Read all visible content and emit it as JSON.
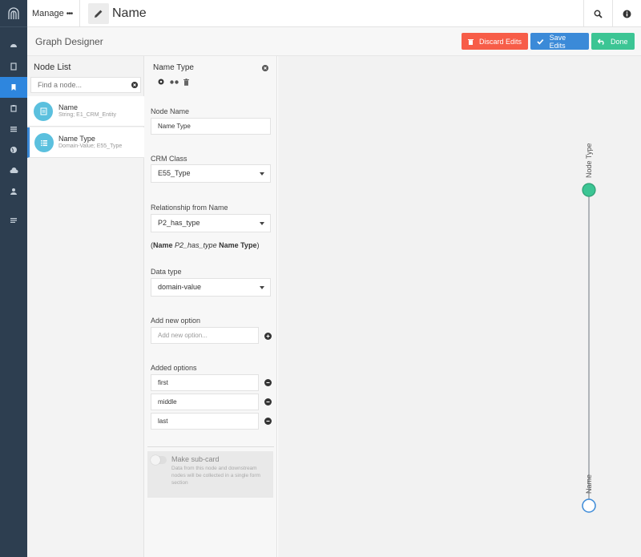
{
  "topbar": {
    "manage_label": "Manage",
    "manage_dots": "•••",
    "page_title": "Name"
  },
  "toolbar": {
    "section_title": "Graph Designer",
    "discard_label": "Discard Edits",
    "save_label": "Save Edits",
    "done_label": "Done"
  },
  "node_list": {
    "title": "Node List",
    "search_placeholder": "Find a node...",
    "items": [
      {
        "name": "Name",
        "sub": "String; E1_CRM_Entity"
      },
      {
        "name": "Name Type",
        "sub": "Domain-Value; E55_Type"
      }
    ]
  },
  "form": {
    "header_title": "Name Type",
    "node_name_label": "Node Name",
    "node_name_value": "Name Type",
    "crm_class_label": "CRM Class",
    "crm_class_value": "E55_Type",
    "relationship_label": "Relationship from Name",
    "relationship_value": "P2_has_type",
    "relationship_text": {
      "open": "(",
      "from": "Name",
      "rel": "P2_has_type",
      "to": "Name Type",
      "close": ")"
    },
    "data_type_label": "Data type",
    "data_type_value": "domain-value",
    "add_option_label": "Add new option",
    "add_option_placeholder": "Add new option...",
    "added_options_label": "Added options",
    "options": [
      "first",
      "middle",
      "last"
    ],
    "subcard_title": "Make sub-card",
    "subcard_desc": "Data from this node and downstream nodes will be collected in a single form section"
  },
  "graph": {
    "nodes": [
      {
        "label": "Node Type"
      },
      {
        "label": "Name"
      }
    ],
    "colors": {
      "selected_node": "#3cc594",
      "root_node_stroke": "#3b8ad8",
      "edge": "#9aa0a6"
    }
  },
  "colors": {
    "sidebar": "#2d3e50",
    "active_nav": "#2e86de",
    "discard": "#f75d48",
    "save": "#3b8ad8",
    "done": "#3cc594",
    "node_circle": "#5bc0de"
  }
}
